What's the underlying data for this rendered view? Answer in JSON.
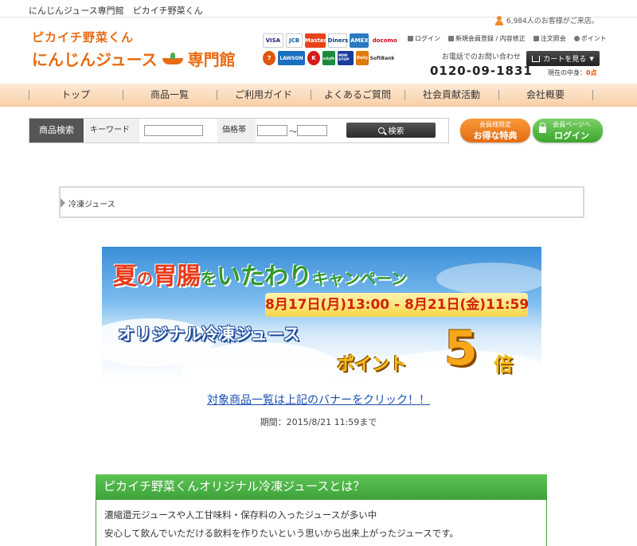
{
  "topbar": {
    "tagline": "にんじんジュース専門館　ピカイチ野菜くん"
  },
  "visitor": {
    "text": "6,984人のお客様がご来店。"
  },
  "logo": {
    "line1": "ピカイチ野菜くん",
    "line2a": "にんじんジュース",
    "line2b": "専門館"
  },
  "payment_logos": {
    "row1": [
      "VISA",
      "JCB",
      "Master",
      "Diners",
      "AMEX",
      "docomo"
    ],
    "row2": [
      "7",
      "LAWSON",
      "K",
      "FamilyMart",
      "MINI STOP",
      "Daily",
      "SoftBank"
    ]
  },
  "userlinks": {
    "login": "ログイン",
    "register": "新規会員登録 / 内容修正",
    "orders": "注文照会",
    "points": "ポイント"
  },
  "phone": {
    "label": "お電話でのお問い合わせ",
    "number": "0120-09-1831"
  },
  "cart": {
    "button": "カートを見る",
    "status_label": "現在の中身：",
    "status_value": "0点"
  },
  "nav": {
    "items": [
      "トップ",
      "商品一覧",
      "ご利用ガイド",
      "よくあるご質問",
      "社会貢献活動",
      "会社概要"
    ]
  },
  "search": {
    "label": "商品検索",
    "keyword_label": "キーワード",
    "price_label": "価格帯",
    "tilde": "〜",
    "button": "検索"
  },
  "buttons": {
    "benefit_top": "会員様限定",
    "benefit_bottom": "お得な特典",
    "mypage_top": "会員ページへ",
    "mypage_bottom": "ログイン"
  },
  "breadcrumb": {
    "current": "冷凍ジュース"
  },
  "banner": {
    "title_c1": "夏",
    "title_c2": "の",
    "title_c3": "胃腸",
    "title_c4": "を",
    "title_c5": "いたわり",
    "title_c6": "キャンペーン",
    "period": "8月17日(月)13:00 - 8月21日(金)11:59",
    "line2": "オリジナル冷凍ジュース",
    "point": "ポイント",
    "multiplier": "5",
    "times": "倍"
  },
  "promo": {
    "link": "対象商品一覧は上記のバナーをクリック！！",
    "period": "期間：2015/8/21 11:59まで"
  },
  "about": {
    "heading": "ピカイチ野菜くんオリジナル冷凍ジュースとは？",
    "line1": "濃縮還元ジュースや人工甘味料・保存料の入ったジュースが多い中",
    "line2": "安心して飲んでいただける飲料を作りたいという思いから出来上がったジュースです。"
  },
  "colors": {
    "accent_orange": "#e96b12",
    "nav_bg": "#fde9d5",
    "green": "#3fa33a",
    "link": "#1a4fb0"
  }
}
